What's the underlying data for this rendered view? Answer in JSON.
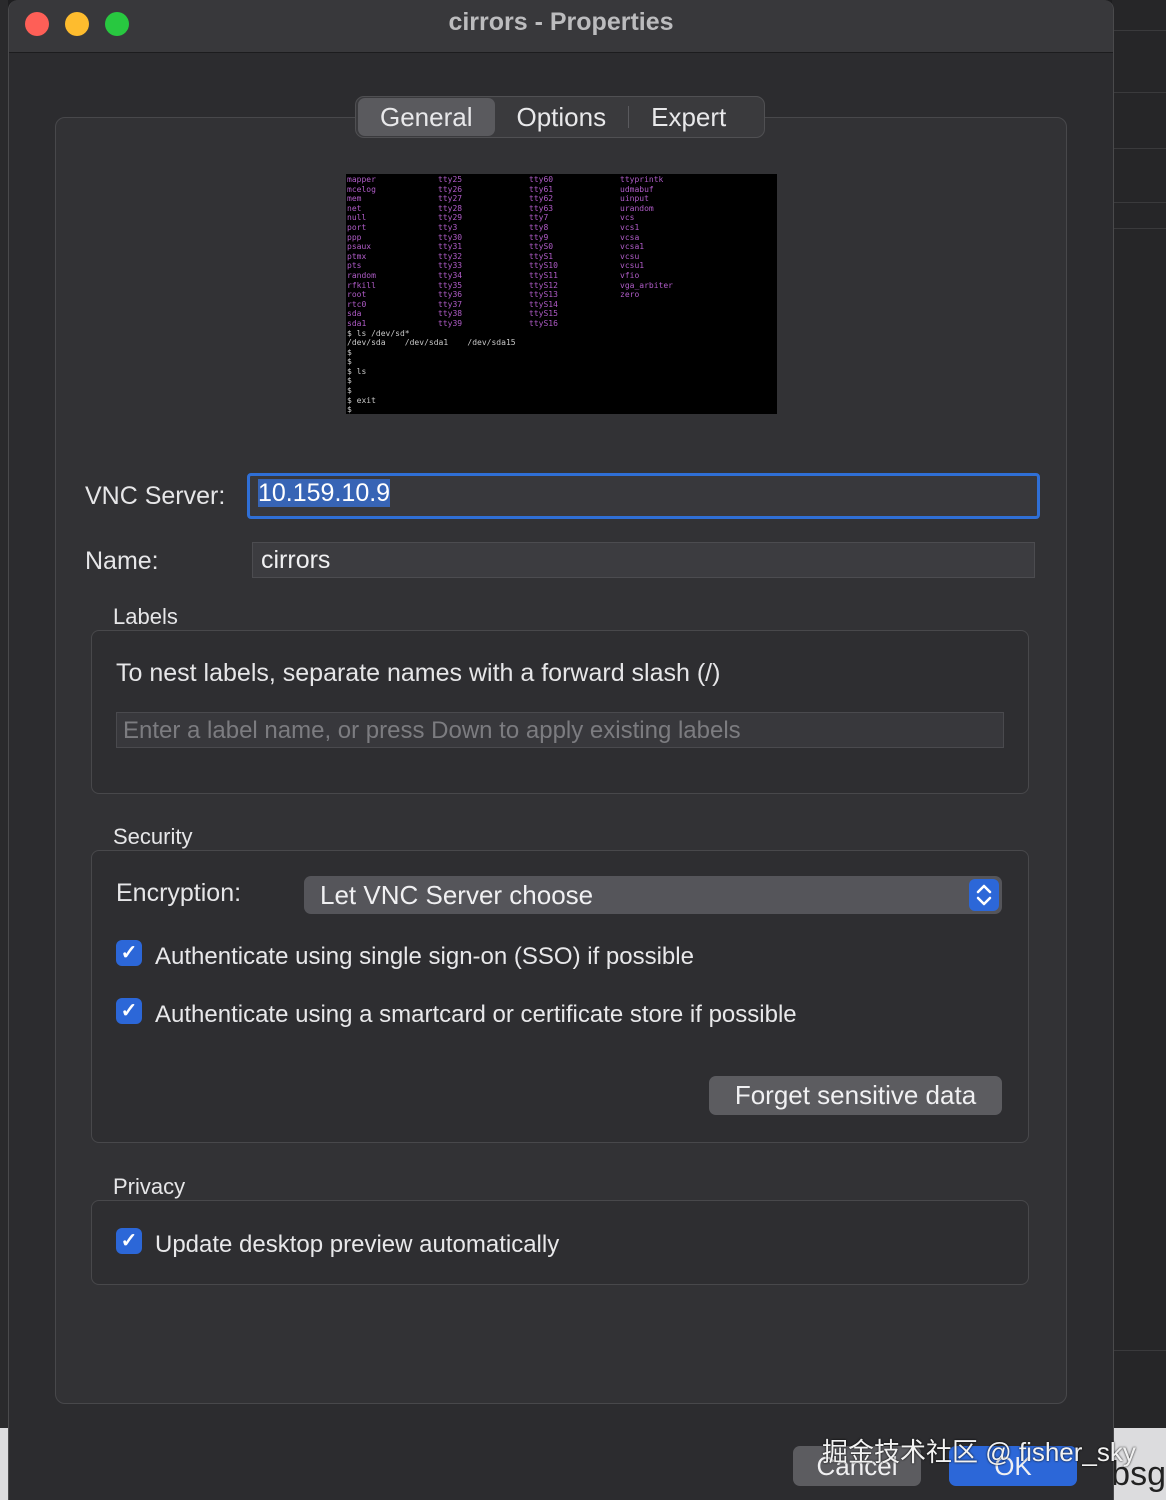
{
  "window": {
    "title": "cirrors - Properties"
  },
  "tabs": [
    {
      "label": "General",
      "active": true
    },
    {
      "label": "Options",
      "active": false
    },
    {
      "label": "Expert",
      "active": false
    }
  ],
  "preview": {
    "columns": [
      [
        "mapper",
        "mcelog",
        "mem",
        "net",
        "null",
        "port",
        "ppp",
        "psaux",
        "ptmx",
        "pts",
        "random",
        "rfkill",
        "root",
        "rtc0",
        "sda",
        "sda1",
        "$ ls /dev/sd*",
        "/dev/sda    /dev/sda1    /dev/sda15",
        "$",
        "$",
        "$ ls",
        "$",
        "$",
        "$ exit",
        "$"
      ],
      [
        "tty25",
        "tty26",
        "tty27",
        "tty28",
        "tty29",
        "tty3",
        "tty30",
        "tty31",
        "tty32",
        "tty33",
        "tty34",
        "tty35",
        "tty36",
        "tty37",
        "tty38",
        "tty39"
      ],
      [
        "tty60",
        "tty61",
        "tty62",
        "tty63",
        "tty7",
        "tty8",
        "tty9",
        "ttyS0",
        "ttyS1",
        "ttyS10",
        "ttyS11",
        "ttyS12",
        "ttyS13",
        "ttyS14",
        "ttyS15",
        "ttyS16"
      ],
      [
        "ttyprintk",
        "udmabuf",
        "uinput",
        "urandom",
        "vcs",
        "vcs1",
        "vcsa",
        "vcsa1",
        "vcsu",
        "vcsu1",
        "vfio",
        "vga_arbiter",
        "zero"
      ]
    ]
  },
  "vnc_server": {
    "label": "VNC Server:",
    "value": "10.159.10.9"
  },
  "name": {
    "label": "Name:",
    "value": "cirrors"
  },
  "labels": {
    "title": "Labels",
    "hint": "To nest labels, separate names with a forward slash (/)",
    "placeholder": "Enter a label name, or press Down to apply existing labels"
  },
  "security": {
    "title": "Security",
    "encryption_label": "Encryption:",
    "encryption_value": "Let VNC Server choose",
    "sso_label": "Authenticate using single sign-on (SSO) if possible",
    "sso_checked": true,
    "smartcard_label": "Authenticate using a smartcard or certificate store if possible",
    "smartcard_checked": true,
    "forget_button": "Forget sensitive data"
  },
  "privacy": {
    "title": "Privacy",
    "update_preview_label": "Update desktop preview automatically",
    "update_preview_checked": true
  },
  "footer": {
    "cancel": "Cancel",
    "ok": "OK"
  },
  "watermark": "掘金技术社区 @ fisher_sky",
  "background": {
    "right_text": "ıbsg"
  },
  "colors": {
    "accent": "#2c67d8",
    "close": "#fe5f57",
    "minimize": "#febc2e",
    "maximize": "#28c840"
  }
}
